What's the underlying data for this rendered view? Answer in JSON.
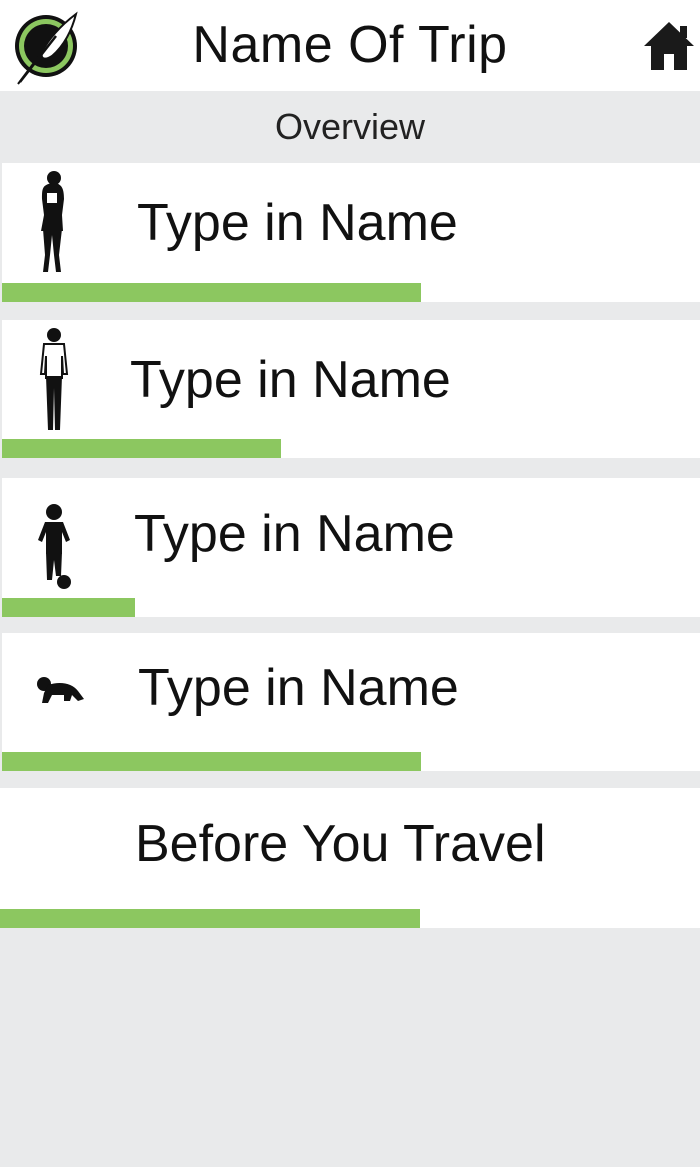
{
  "header": {
    "title": "Name Of Trip",
    "logo_icon": "feather-logo-icon",
    "home_icon": "home-icon"
  },
  "subheader": {
    "label": "Overview"
  },
  "colors": {
    "accent": "#8cc760",
    "background": "#e9eaeb",
    "card": "#ffffff"
  },
  "travelers": [
    {
      "label": "Type in Name",
      "icon": "woman-silhouette-icon",
      "progress": 0.6
    },
    {
      "label": "Type in Name",
      "icon": "man-silhouette-icon",
      "progress": 0.4
    },
    {
      "label": "Type in Name",
      "icon": "child-silhouette-icon",
      "progress": 0.19
    },
    {
      "label": "Type in Name",
      "icon": "baby-silhouette-icon",
      "progress": 0.6
    }
  ],
  "before_travel": {
    "label": "Before You Travel",
    "progress": 0.6
  }
}
